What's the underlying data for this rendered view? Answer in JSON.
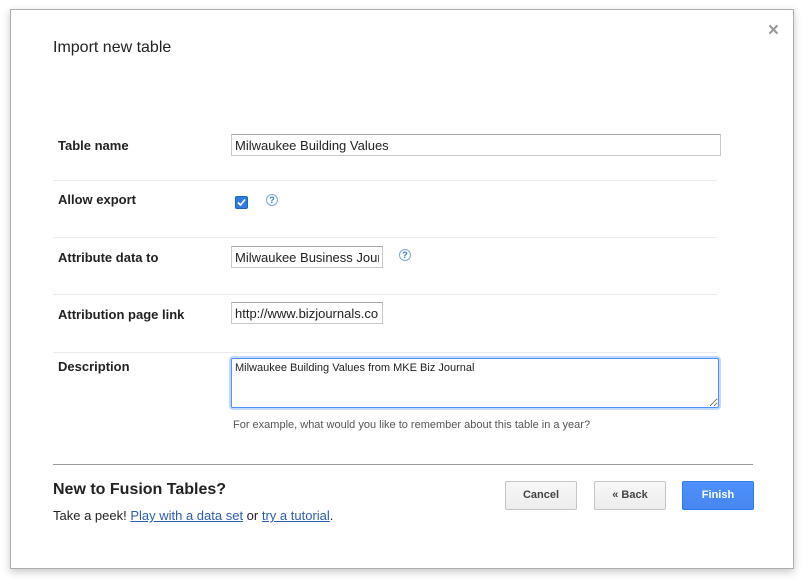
{
  "dialog": {
    "title": "Import new table",
    "close_glyph": "×"
  },
  "form": {
    "table_name": {
      "label": "Table name",
      "value": "Milwaukee Building Values"
    },
    "allow_export": {
      "label": "Allow export",
      "checked": true,
      "help_glyph": "?"
    },
    "attribute_data_to": {
      "label": "Attribute data to",
      "value": "Milwaukee Business Journal",
      "help_glyph": "?"
    },
    "attribution_page_link": {
      "label": "Attribution page link",
      "value": "http://www.bizjournals.com"
    },
    "description": {
      "label": "Description",
      "value": "Milwaukee Building Values from MKE Biz Journal",
      "hint": "For example, what would you like to remember about this table in a year?"
    }
  },
  "footer": {
    "title": "New to Fusion Tables?",
    "text_prefix": "Take a peek! ",
    "link_play": "Play with a data set",
    "text_or": " or ",
    "link_tutorial": "try a tutorial",
    "text_suffix": "."
  },
  "buttons": {
    "cancel": "Cancel",
    "back": "« Back",
    "finish": "Finish"
  },
  "colors": {
    "accent": "#4d90fe",
    "link": "#2a5db0",
    "checkbox": "#2f7de1"
  }
}
